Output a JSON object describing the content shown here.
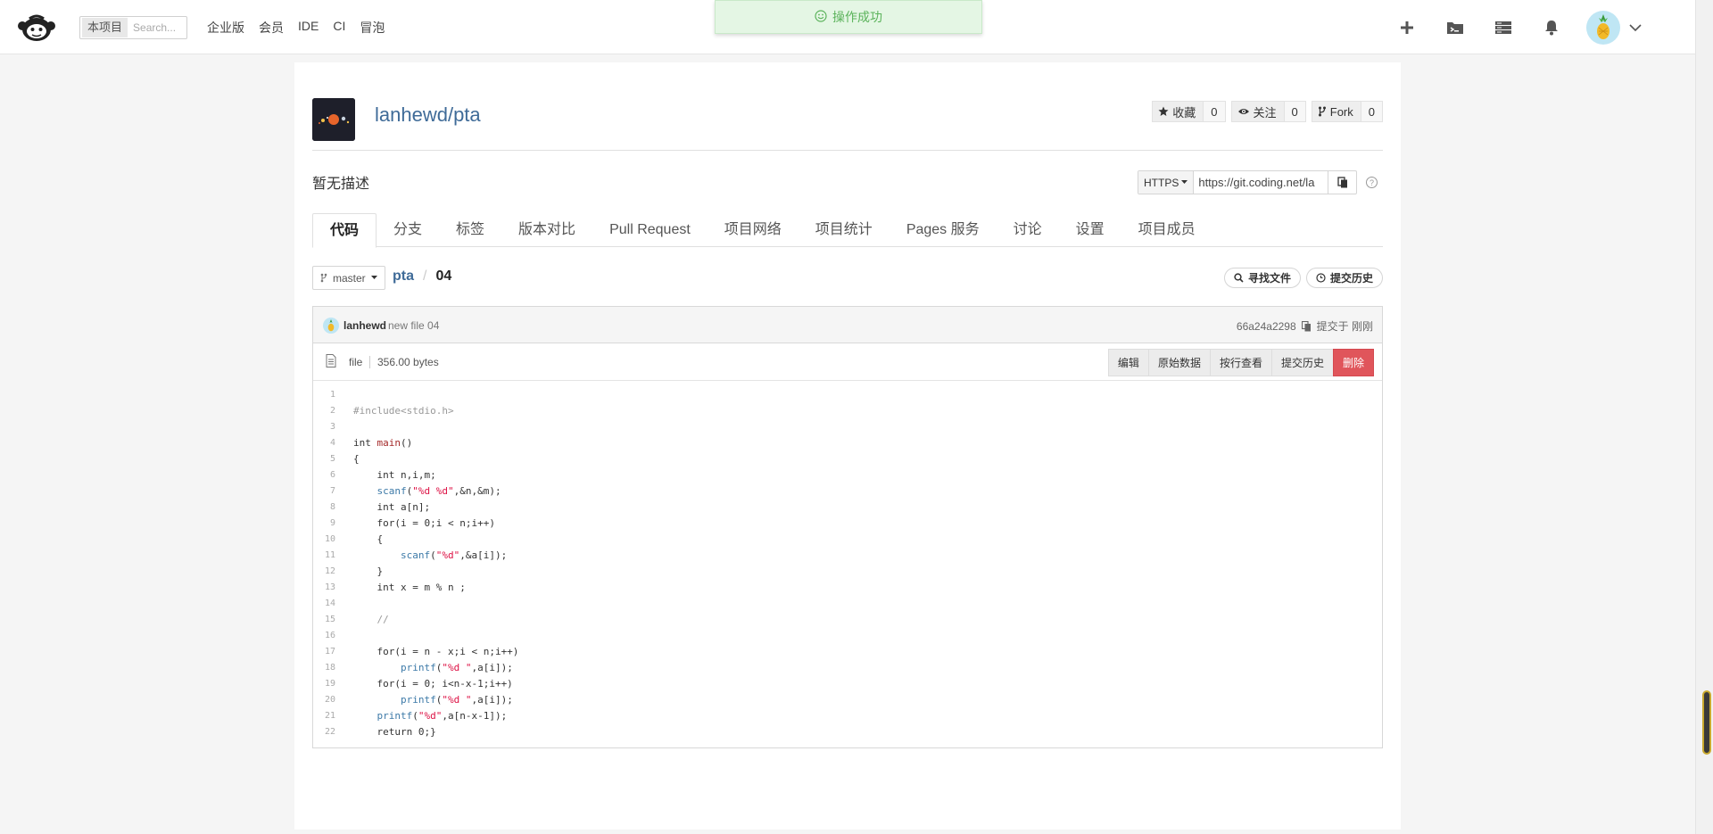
{
  "nav": {
    "search_scope": "本项目",
    "search_placeholder": "Search...",
    "links": [
      "企业版",
      "会员",
      "IDE",
      "CI",
      "冒泡"
    ]
  },
  "toast": {
    "text": "操作成功"
  },
  "project": {
    "title": "lanhewd/pta",
    "description": "暂无描述",
    "actions": {
      "star_label": "收藏",
      "star_count": "0",
      "watch_label": "关注",
      "watch_count": "0",
      "fork_label": "Fork",
      "fork_count": "0"
    },
    "clone": {
      "protocol": "HTTPS",
      "url": "https://git.coding.net/la"
    }
  },
  "tabs": [
    "代码",
    "分支",
    "标签",
    "版本对比",
    "Pull Request",
    "项目网络",
    "项目统计",
    "Pages 服务",
    "讨论",
    "设置",
    "项目成员"
  ],
  "branch": {
    "name": "master",
    "crumb_root": "pta",
    "crumb_sep": "/",
    "crumb_current": "04",
    "find_file": "寻找文件",
    "history": "提交历史"
  },
  "commit": {
    "author": "lanhewd",
    "message": "new file 04",
    "hash": "66a24a2298",
    "time": "提交于 刚刚"
  },
  "file": {
    "type": "file",
    "size": "356.00 bytes",
    "buttons": {
      "edit": "编辑",
      "raw": "原始数据",
      "blame": "按行查看",
      "history": "提交历史",
      "delete": "删除"
    }
  },
  "code_lines": [
    "",
    "#include<stdio.h>",
    "",
    "int main()",
    "{",
    "    int n,i,m;",
    "    scanf(\"%d %d\",&n,&m);",
    "    int a[n];",
    "    for(i = 0;i < n;i++)",
    "    {",
    "        scanf(\"%d\",&a[i]);",
    "    }",
    "    int x = m % n ;",
    "",
    "    //",
    "",
    "    for(i = n - x;i < n;i++)",
    "        printf(\"%d \",a[i]);",
    "    for(i = 0; i<n-x-1;i++)",
    "        printf(\"%d \",a[i]);",
    "    printf(\"%d\",a[n-x-1]);",
    "    return 0;}"
  ],
  "colors": {
    "link": "#3f6b98",
    "danger": "#e0555b",
    "toast_text": "#5bb35b",
    "toast_bg": "#e4f6e4",
    "code_keyword": "#333333",
    "code_string": "#dd1144",
    "code_func": "#3d7aa8",
    "code_comment": "#999999"
  }
}
